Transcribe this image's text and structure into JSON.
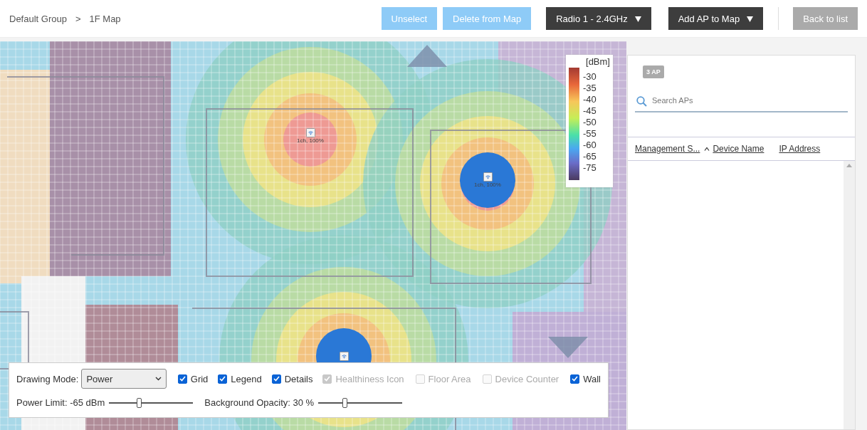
{
  "breadcrumb": {
    "items": [
      "Default Group",
      "1F Map"
    ],
    "separator": ">"
  },
  "toolbar": [
    {
      "kind": "primary",
      "label": "Unselect"
    },
    {
      "kind": "primary",
      "label": "Delete from Map"
    },
    {
      "kind": "dropdown",
      "label": "Radio 1 - 2.4GHz"
    },
    {
      "kind": "dropdown",
      "label": "Add AP to Map"
    },
    {
      "kind": "secondary",
      "label": "Back to list"
    }
  ],
  "access_points": [
    {
      "label": "1ch, 100%",
      "selected": false
    },
    {
      "label": "1ch, 100%",
      "selected": true
    },
    {
      "selected": true
    }
  ],
  "legend": {
    "unit": "[dBm]",
    "ticks": [
      "-30",
      "-35",
      "-40",
      "-45",
      "-50",
      "-55",
      "-60",
      "-65",
      "-75"
    ]
  },
  "panel": {
    "badge": "3 AP",
    "search": {
      "placeholder": "Search APs"
    },
    "columns": [
      {
        "label": "Management S...",
        "sorted": false
      },
      {
        "label": "Device Name",
        "sorted": true
      },
      {
        "label": "IP Address",
        "sorted": false
      }
    ]
  },
  "controls": {
    "drawing_mode": {
      "label": "Drawing Mode:",
      "value": "Power"
    },
    "checkboxes": [
      {
        "label": "Grid",
        "checked": true,
        "disabled": false
      },
      {
        "label": "Legend",
        "checked": true,
        "disabled": false
      },
      {
        "label": "Details",
        "checked": true,
        "disabled": false
      },
      {
        "label": "Healthiness Icon",
        "checked": true,
        "disabled": true
      },
      {
        "label": "Floor Area",
        "checked": false,
        "disabled": true
      },
      {
        "label": "Device Counter",
        "checked": false,
        "disabled": true
      },
      {
        "label": "Wall",
        "checked": true,
        "disabled": false
      }
    ],
    "sliders": [
      {
        "label": "Power Limit: -65 dBm",
        "level": 0.36
      },
      {
        "label": "Background Opacity: 30 %",
        "level": 0.32
      }
    ]
  }
}
